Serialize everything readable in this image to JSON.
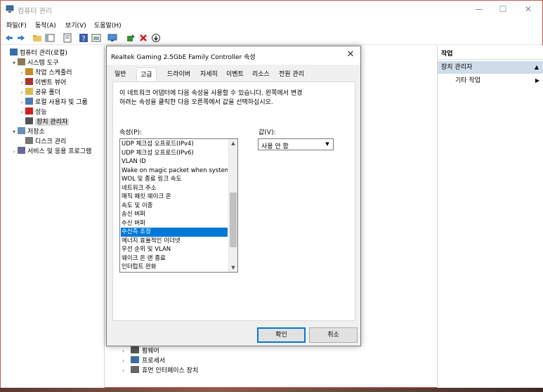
{
  "window": {
    "title": "컴퓨터 관리",
    "controls": {
      "minimize": "—",
      "maximize": "☐",
      "close": "✕"
    }
  },
  "menubar": [
    "파일(F)",
    "동작(A)",
    "보기(V)",
    "도움말(H)"
  ],
  "tree": [
    {
      "label": "컴퓨터 관리(로컬)",
      "icon": "computer-icon",
      "indent": 0,
      "arrow": ""
    },
    {
      "label": "시스템 도구",
      "icon": "tools-icon",
      "indent": 1,
      "arrow": "▾"
    },
    {
      "label": "작업 스케줄러",
      "icon": "clock-icon",
      "indent": 2,
      "arrow": "›"
    },
    {
      "label": "이벤트 뷰어",
      "icon": "event-icon",
      "indent": 2,
      "arrow": "›"
    },
    {
      "label": "공유 폴더",
      "icon": "folder-icon",
      "indent": 2,
      "arrow": "›"
    },
    {
      "label": "로컬 사용자 및 그룹",
      "icon": "users-icon",
      "indent": 2,
      "arrow": "›"
    },
    {
      "label": "성능",
      "icon": "performance-icon",
      "indent": 2,
      "arrow": "›"
    },
    {
      "label": "장치 관리자",
      "icon": "device-manager-icon",
      "indent": 2,
      "arrow": "",
      "selected": true
    },
    {
      "label": "저장소",
      "icon": "storage-icon",
      "indent": 1,
      "arrow": "▾"
    },
    {
      "label": "디스크 관리",
      "icon": "disk-icon",
      "indent": 2,
      "arrow": ""
    },
    {
      "label": "서비스 및 응용 프로그램",
      "icon": "services-icon",
      "indent": 1,
      "arrow": "›"
    }
  ],
  "middle_rows": [
    {
      "label": "펌웨어",
      "icon": "firmware-icon"
    },
    {
      "label": "프로세서",
      "icon": "processor-icon"
    },
    {
      "label": "휴먼 인터페이스 장치",
      "icon": "hid-icon"
    }
  ],
  "actions": {
    "header": "작업",
    "section": "장치 관리자",
    "item": "기타 작업"
  },
  "dialog": {
    "title": "Realtek Gaming 2.5GbE Family Controller 속성",
    "tabs": [
      "일반",
      "고급",
      "드라이버",
      "자세히",
      "이벤트",
      "리소스",
      "전원 관리"
    ],
    "active_tab": 1,
    "description_line1": "이 네트워크 어댑터에 다음 속성을 사용할 수 있습니다. 왼쪽에서 변경",
    "description_line2": "하려는 속성을 클릭한 다음 오른쪽에서 값을 선택하십시오.",
    "property_label": "속성(P):",
    "value_label": "값(V):",
    "properties": [
      "UDP 체크섬 오프로드(IPv4)",
      "UDP 체크섬 오프로드(IPv6)",
      "VLAN ID",
      "Wake on magic packet when system",
      "WOL 및 종료 링크 속도",
      "네트워크 주소",
      "매직 패킷 웨이크 온",
      "속도 및 이중",
      "송신 버퍼",
      "수신 버퍼",
      "수신측 조정",
      "에너지 효율적인 이더넷",
      "우선 순위 및 VLAN",
      "웨이크 온 랜 종료",
      "인터럽트 완화"
    ],
    "selected_property_index": 10,
    "value": "사용 안 함",
    "ok_label": "확인",
    "cancel_label": "취소"
  },
  "colors": {
    "selection": "#0078d7",
    "actions_section": "#cfdcea",
    "window_border": "#c85a4c"
  }
}
